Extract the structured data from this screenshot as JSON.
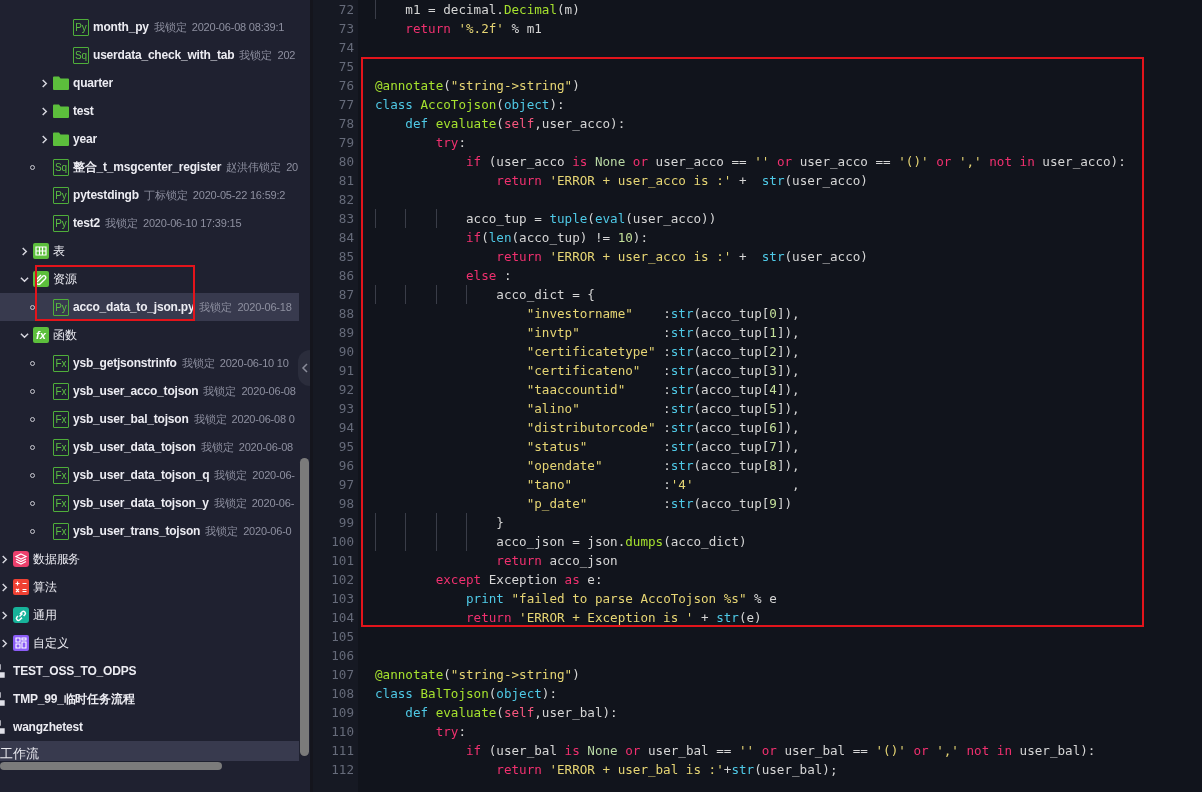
{
  "sidebar": {
    "tree": [
      {
        "kind": "hidden",
        "children": [
          {
            "kind": "hidden",
            "children": [
              {
                "kind": "hidden",
                "children": [
                  {
                    "kind": "hidden",
                    "children": [
                      {
                        "kind": "file",
                        "badge": "Py",
                        "label": "month_py",
                        "owner": "我锁定",
                        "time": "2020-06-08 08:39:1",
                        "dot": false,
                        "selected": false
                      },
                      {
                        "kind": "file",
                        "badge": "Sq",
                        "label": "userdata_check_with_tab",
                        "owner": "我锁定",
                        "time": "202",
                        "dot": false,
                        "selected": false
                      }
                    ]
                  },
                  {
                    "kind": "folder",
                    "label": "quarter",
                    "expanded": false,
                    "selected": false
                  },
                  {
                    "kind": "folder",
                    "label": "test",
                    "expanded": false,
                    "selected": false
                  },
                  {
                    "kind": "folder",
                    "label": "year",
                    "expanded": false,
                    "selected": false
                  },
                  {
                    "kind": "file",
                    "badge": "Sq",
                    "label": "整合_t_msgcenter_register",
                    "owner": "赵洪伟锁定",
                    "time": "20",
                    "dot": true,
                    "selected": false
                  },
                  {
                    "kind": "file",
                    "badge": "Py",
                    "label": "pytestdingb",
                    "owner": "丁标锁定",
                    "time": "2020-05-22 16:59:2",
                    "dot": false,
                    "selected": false
                  },
                  {
                    "kind": "file",
                    "badge": "Py",
                    "label": "test2",
                    "owner": "我锁定",
                    "time": "2020-06-10 17:39:15",
                    "dot": false,
                    "selected": false
                  }
                ]
              },
              {
                "kind": "table",
                "label": "表",
                "expanded": false,
                "boxed": false,
                "selected": false
              },
              {
                "kind": "resource",
                "label": "资源",
                "expanded": true,
                "boxed": true,
                "selected": false,
                "children": [
                  {
                    "kind": "file",
                    "badge": "Py",
                    "label": "acco_data_to_json.py",
                    "owner": "我锁定",
                    "time": "2020-06-18",
                    "dot": true,
                    "selected": true
                  }
                ]
              },
              {
                "kind": "function",
                "badge": "fx",
                "label": "函数",
                "expanded": true,
                "boxed": false,
                "selected": false,
                "children": [
                  {
                    "kind": "file",
                    "badge": "Fx",
                    "label": "ysb_getjsonstrinfo",
                    "owner": "我锁定",
                    "time": "2020-06-10 10",
                    "dot": true,
                    "selected": false
                  },
                  {
                    "kind": "file",
                    "badge": "Fx",
                    "label": "ysb_user_acco_tojson",
                    "owner": "我锁定",
                    "time": "2020-06-08",
                    "dot": true,
                    "selected": false
                  },
                  {
                    "kind": "file",
                    "badge": "Fx",
                    "label": "ysb_user_bal_tojson",
                    "owner": "我锁定",
                    "time": "2020-06-08 0",
                    "dot": true,
                    "selected": false
                  },
                  {
                    "kind": "file",
                    "badge": "Fx",
                    "label": "ysb_user_data_tojson",
                    "owner": "我锁定",
                    "time": "2020-06-08",
                    "dot": true,
                    "selected": false
                  },
                  {
                    "kind": "file",
                    "badge": "Fx",
                    "label": "ysb_user_data_tojson_q",
                    "owner": "我锁定",
                    "time": "2020-06-",
                    "dot": true,
                    "selected": false
                  },
                  {
                    "kind": "file",
                    "badge": "Fx",
                    "label": "ysb_user_data_tojson_y",
                    "owner": "我锁定",
                    "time": "2020-06-",
                    "dot": true,
                    "selected": false
                  },
                  {
                    "kind": "file",
                    "badge": "Fx",
                    "label": "ysb_user_trans_tojson",
                    "owner": "我锁定",
                    "time": "2020-06-0",
                    "dot": true,
                    "selected": false
                  }
                ]
              }
            ]
          },
          {
            "kind": "service",
            "label": "数据服务",
            "expanded": false,
            "boxed": false,
            "selected": false
          },
          {
            "kind": "algorithm",
            "label": "算法",
            "expanded": false,
            "boxed": false,
            "selected": false
          },
          {
            "kind": "general",
            "label": "通用",
            "expanded": false,
            "boxed": false,
            "selected": false
          },
          {
            "kind": "custom",
            "label": "自定义",
            "expanded": false,
            "boxed": false,
            "selected": false
          }
        ]
      },
      {
        "kind": "workflow",
        "label": "TEST_OSS_TO_ODPS",
        "selected": false
      },
      {
        "kind": "workflow",
        "label": "TMP_99_临时任务流程",
        "selected": false
      },
      {
        "kind": "workflow",
        "label": "wangzhetest",
        "selected": false
      },
      {
        "kind": "section",
        "label": "工作流",
        "selected": true
      }
    ]
  },
  "editor": {
    "lines": [
      {
        "number": "72",
        "boxed": false,
        "tokens": [
          {
            "kind": "plain",
            "text": "    m1 = decimal."
          },
          {
            "kind": "fn",
            "text": "Decimal"
          },
          {
            "kind": "plain",
            "text": "(m)"
          }
        ]
      },
      {
        "number": "73",
        "boxed": false,
        "tokens": [
          {
            "kind": "kw",
            "text": "    return "
          },
          {
            "kind": "str",
            "text": "'%.2f'"
          },
          {
            "kind": "plain",
            "text": " % m1"
          }
        ]
      },
      {
        "number": "74",
        "boxed": false
      },
      {
        "number": "75",
        "boxed": true
      },
      {
        "number": "76",
        "boxed": true,
        "tokens": [
          {
            "kind": "fn",
            "text": "@annotate"
          },
          {
            "kind": "plain",
            "text": "("
          },
          {
            "kind": "str",
            "text": "\"string->string\""
          },
          {
            "kind": "plain",
            "text": ")"
          }
        ]
      },
      {
        "number": "77",
        "boxed": true,
        "tokens": [
          {
            "kind": "builtin",
            "text": "class "
          },
          {
            "kind": "fn",
            "text": "AccoTojson"
          },
          {
            "kind": "plain",
            "text": "("
          },
          {
            "kind": "builtin",
            "text": "object"
          },
          {
            "kind": "plain",
            "text": "):"
          }
        ]
      },
      {
        "number": "78",
        "boxed": true,
        "tokens": [
          {
            "kind": "builtin",
            "text": "    def "
          },
          {
            "kind": "fn",
            "text": "evaluate"
          },
          {
            "kind": "plain",
            "text": "("
          },
          {
            "kind": "self",
            "text": "self"
          },
          {
            "kind": "plain",
            "text": ",user_acco):"
          }
        ]
      },
      {
        "number": "79",
        "boxed": true,
        "tokens": [
          {
            "kind": "kw",
            "text": "        try"
          },
          {
            "kind": "plain",
            "text": ":"
          }
        ]
      },
      {
        "number": "80",
        "boxed": true,
        "tokens": [
          {
            "kind": "kw",
            "text": "            if"
          },
          {
            "kind": "plain",
            "text": " (user_acco "
          },
          {
            "kind": "kw",
            "text": "is "
          },
          {
            "kind": "const",
            "text": "None "
          },
          {
            "kind": "kw",
            "text": "or"
          },
          {
            "kind": "plain",
            "text": " user_acco == "
          },
          {
            "kind": "str",
            "text": "'' "
          },
          {
            "kind": "kw",
            "text": "or"
          },
          {
            "kind": "plain",
            "text": " user_acco == "
          },
          {
            "kind": "str",
            "text": "'()' "
          },
          {
            "kind": "kw",
            "text": "or "
          },
          {
            "kind": "str",
            "text": "',' "
          },
          {
            "kind": "kw",
            "text": "not in"
          },
          {
            "kind": "plain",
            "text": " user_acco):"
          }
        ]
      },
      {
        "number": "81",
        "boxed": true,
        "tokens": [
          {
            "kind": "kw",
            "text": "                return "
          },
          {
            "kind": "str",
            "text": "'ERROR + user_acco is :'"
          },
          {
            "kind": "plain",
            "text": " +  "
          },
          {
            "kind": "builtin",
            "text": "str"
          },
          {
            "kind": "plain",
            "text": "(user_acco)"
          }
        ]
      },
      {
        "number": "82",
        "boxed": true
      },
      {
        "number": "83",
        "boxed": true,
        "tokens": [
          {
            "kind": "plain",
            "text": "            acco_tup = "
          },
          {
            "kind": "builtin",
            "text": "tuple"
          },
          {
            "kind": "plain",
            "text": "("
          },
          {
            "kind": "builtin",
            "text": "eval"
          },
          {
            "kind": "plain",
            "text": "(user_acco))"
          }
        ]
      },
      {
        "number": "84",
        "boxed": true,
        "tokens": [
          {
            "kind": "kw",
            "text": "            if"
          },
          {
            "kind": "plain",
            "text": "("
          },
          {
            "kind": "builtin",
            "text": "len"
          },
          {
            "kind": "plain",
            "text": "(acco_tup) != "
          },
          {
            "kind": "num",
            "text": "10"
          },
          {
            "kind": "plain",
            "text": "):"
          }
        ]
      },
      {
        "number": "85",
        "boxed": true,
        "tokens": [
          {
            "kind": "kw",
            "text": "                return "
          },
          {
            "kind": "str",
            "text": "'ERROR + user_acco is :'"
          },
          {
            "kind": "plain",
            "text": " +  "
          },
          {
            "kind": "builtin",
            "text": "str"
          },
          {
            "kind": "plain",
            "text": "(user_acco)"
          }
        ]
      },
      {
        "number": "86",
        "boxed": true,
        "tokens": [
          {
            "kind": "kw",
            "text": "            else"
          },
          {
            "kind": "plain",
            "text": " :"
          }
        ]
      },
      {
        "number": "87",
        "boxed": true,
        "tokens": [
          {
            "kind": "plain",
            "text": "                acco_dict = {"
          }
        ]
      },
      {
        "number": "88",
        "boxed": true,
        "tokens": [
          {
            "kind": "str",
            "text": "                    \"investorname\""
          },
          {
            "kind": "plain",
            "text": "    :"
          },
          {
            "kind": "builtin",
            "text": "str"
          },
          {
            "kind": "plain",
            "text": "(acco_tup["
          },
          {
            "kind": "num",
            "text": "0"
          },
          {
            "kind": "plain",
            "text": "]),"
          }
        ]
      },
      {
        "number": "89",
        "boxed": true,
        "tokens": [
          {
            "kind": "str",
            "text": "                    \"invtp\""
          },
          {
            "kind": "plain",
            "text": "           :"
          },
          {
            "kind": "builtin",
            "text": "str"
          },
          {
            "kind": "plain",
            "text": "(acco_tup["
          },
          {
            "kind": "num",
            "text": "1"
          },
          {
            "kind": "plain",
            "text": "]),"
          }
        ]
      },
      {
        "number": "90",
        "boxed": true,
        "tokens": [
          {
            "kind": "str",
            "text": "                    \"certificatetype\""
          },
          {
            "kind": "plain",
            "text": " :"
          },
          {
            "kind": "builtin",
            "text": "str"
          },
          {
            "kind": "plain",
            "text": "(acco_tup["
          },
          {
            "kind": "num",
            "text": "2"
          },
          {
            "kind": "plain",
            "text": "]),"
          }
        ]
      },
      {
        "number": "91",
        "boxed": true,
        "tokens": [
          {
            "kind": "str",
            "text": "                    \"certificateno\""
          },
          {
            "kind": "plain",
            "text": "   :"
          },
          {
            "kind": "builtin",
            "text": "str"
          },
          {
            "kind": "plain",
            "text": "(acco_tup["
          },
          {
            "kind": "num",
            "text": "3"
          },
          {
            "kind": "plain",
            "text": "]),"
          }
        ]
      },
      {
        "number": "92",
        "boxed": true,
        "tokens": [
          {
            "kind": "str",
            "text": "                    \"taaccountid\""
          },
          {
            "kind": "plain",
            "text": "     :"
          },
          {
            "kind": "builtin",
            "text": "str"
          },
          {
            "kind": "plain",
            "text": "(acco_tup["
          },
          {
            "kind": "num",
            "text": "4"
          },
          {
            "kind": "plain",
            "text": "]),"
          }
        ]
      },
      {
        "number": "93",
        "boxed": true,
        "tokens": [
          {
            "kind": "str",
            "text": "                    \"alino\""
          },
          {
            "kind": "plain",
            "text": "           :"
          },
          {
            "kind": "builtin",
            "text": "str"
          },
          {
            "kind": "plain",
            "text": "(acco_tup["
          },
          {
            "kind": "num",
            "text": "5"
          },
          {
            "kind": "plain",
            "text": "]),"
          }
        ]
      },
      {
        "number": "94",
        "boxed": true,
        "tokens": [
          {
            "kind": "str",
            "text": "                    \"distributorcode\""
          },
          {
            "kind": "plain",
            "text": " :"
          },
          {
            "kind": "builtin",
            "text": "str"
          },
          {
            "kind": "plain",
            "text": "(acco_tup["
          },
          {
            "kind": "num",
            "text": "6"
          },
          {
            "kind": "plain",
            "text": "]),"
          }
        ]
      },
      {
        "number": "95",
        "boxed": true,
        "tokens": [
          {
            "kind": "str",
            "text": "                    \"status\""
          },
          {
            "kind": "plain",
            "text": "          :"
          },
          {
            "kind": "builtin",
            "text": "str"
          },
          {
            "kind": "plain",
            "text": "(acco_tup["
          },
          {
            "kind": "num",
            "text": "7"
          },
          {
            "kind": "plain",
            "text": "]),"
          }
        ]
      },
      {
        "number": "96",
        "boxed": true,
        "tokens": [
          {
            "kind": "str",
            "text": "                    \"opendate\""
          },
          {
            "kind": "plain",
            "text": "        :"
          },
          {
            "kind": "builtin",
            "text": "str"
          },
          {
            "kind": "plain",
            "text": "(acco_tup["
          },
          {
            "kind": "num",
            "text": "8"
          },
          {
            "kind": "plain",
            "text": "]),"
          }
        ]
      },
      {
        "number": "97",
        "boxed": true,
        "tokens": [
          {
            "kind": "str",
            "text": "                    \"tano\""
          },
          {
            "kind": "plain",
            "text": "            :"
          },
          {
            "kind": "str",
            "text": "'4'"
          },
          {
            "kind": "plain",
            "text": "             ,"
          }
        ]
      },
      {
        "number": "98",
        "boxed": true,
        "tokens": [
          {
            "kind": "str",
            "text": "                    \"p_date\""
          },
          {
            "kind": "plain",
            "text": "          :"
          },
          {
            "kind": "builtin",
            "text": "str"
          },
          {
            "kind": "plain",
            "text": "(acco_tup["
          },
          {
            "kind": "num",
            "text": "9"
          },
          {
            "kind": "plain",
            "text": "])"
          }
        ]
      },
      {
        "number": "99",
        "boxed": true,
        "tokens": [
          {
            "kind": "plain",
            "text": "                }"
          }
        ]
      },
      {
        "number": "100",
        "boxed": true,
        "tokens": [
          {
            "kind": "plain",
            "text": "                acco_json = json."
          },
          {
            "kind": "fn",
            "text": "dumps"
          },
          {
            "kind": "plain",
            "text": "(acco_dict)"
          }
        ]
      },
      {
        "number": "101",
        "boxed": true,
        "tokens": [
          {
            "kind": "kw",
            "text": "                return"
          },
          {
            "kind": "plain",
            "text": " acco_json"
          }
        ]
      },
      {
        "number": "102",
        "boxed": true,
        "tokens": [
          {
            "kind": "kw",
            "text": "        except"
          },
          {
            "kind": "plain",
            "text": " Exception "
          },
          {
            "kind": "kw",
            "text": "as"
          },
          {
            "kind": "plain",
            "text": " e:"
          }
        ]
      },
      {
        "number": "103",
        "boxed": true,
        "tokens": [
          {
            "kind": "builtin",
            "text": "            print "
          },
          {
            "kind": "str",
            "text": "\"failed to parse AccoTojson %s\""
          },
          {
            "kind": "plain",
            "text": " % e"
          }
        ]
      },
      {
        "number": "104",
        "boxed": true,
        "tokens": [
          {
            "kind": "kw",
            "text": "            return "
          },
          {
            "kind": "str",
            "text": "'ERROR + Exception is '"
          },
          {
            "kind": "plain",
            "text": " + "
          },
          {
            "kind": "builtin",
            "text": "str"
          },
          {
            "kind": "plain",
            "text": "(e)"
          }
        ]
      },
      {
        "number": "105",
        "boxed": false
      },
      {
        "number": "106",
        "boxed": false
      },
      {
        "number": "107",
        "boxed": false,
        "tokens": [
          {
            "kind": "fn",
            "text": "@annotate"
          },
          {
            "kind": "plain",
            "text": "("
          },
          {
            "kind": "str",
            "text": "\"string->string\""
          },
          {
            "kind": "plain",
            "text": ")"
          }
        ]
      },
      {
        "number": "108",
        "boxed": false,
        "tokens": [
          {
            "kind": "builtin",
            "text": "class "
          },
          {
            "kind": "fn",
            "text": "BalTojson"
          },
          {
            "kind": "plain",
            "text": "("
          },
          {
            "kind": "builtin",
            "text": "object"
          },
          {
            "kind": "plain",
            "text": "):"
          }
        ]
      },
      {
        "number": "109",
        "boxed": false,
        "tokens": [
          {
            "kind": "builtin",
            "text": "    def "
          },
          {
            "kind": "fn",
            "text": "evaluate"
          },
          {
            "kind": "plain",
            "text": "("
          },
          {
            "kind": "self",
            "text": "self"
          },
          {
            "kind": "plain",
            "text": ",user_bal):"
          }
        ]
      },
      {
        "number": "110",
        "boxed": false,
        "tokens": [
          {
            "kind": "kw",
            "text": "        try"
          },
          {
            "kind": "plain",
            "text": ":"
          }
        ]
      },
      {
        "number": "111",
        "boxed": false,
        "tokens": [
          {
            "kind": "kw",
            "text": "            if"
          },
          {
            "kind": "plain",
            "text": " (user_bal "
          },
          {
            "kind": "kw",
            "text": "is "
          },
          {
            "kind": "const",
            "text": "None "
          },
          {
            "kind": "kw",
            "text": "or"
          },
          {
            "kind": "plain",
            "text": " user_bal == "
          },
          {
            "kind": "str",
            "text": "'' "
          },
          {
            "kind": "kw",
            "text": "or"
          },
          {
            "kind": "plain",
            "text": " user_bal == "
          },
          {
            "kind": "str",
            "text": "'()' "
          },
          {
            "kind": "kw",
            "text": "or "
          },
          {
            "kind": "str",
            "text": "',' "
          },
          {
            "kind": "kw",
            "text": "not in"
          },
          {
            "kind": "plain",
            "text": " user_bal):"
          }
        ]
      },
      {
        "number": "112",
        "boxed": false,
        "tokens": [
          {
            "kind": "kw",
            "text": "                return "
          },
          {
            "kind": "str",
            "text": "'ERROR + user_bal is :'"
          },
          {
            "kind": "plain",
            "text": "+"
          },
          {
            "kind": "builtin",
            "text": "str"
          },
          {
            "kind": "plain",
            "text": "(user_bal);"
          }
        ]
      }
    ]
  }
}
